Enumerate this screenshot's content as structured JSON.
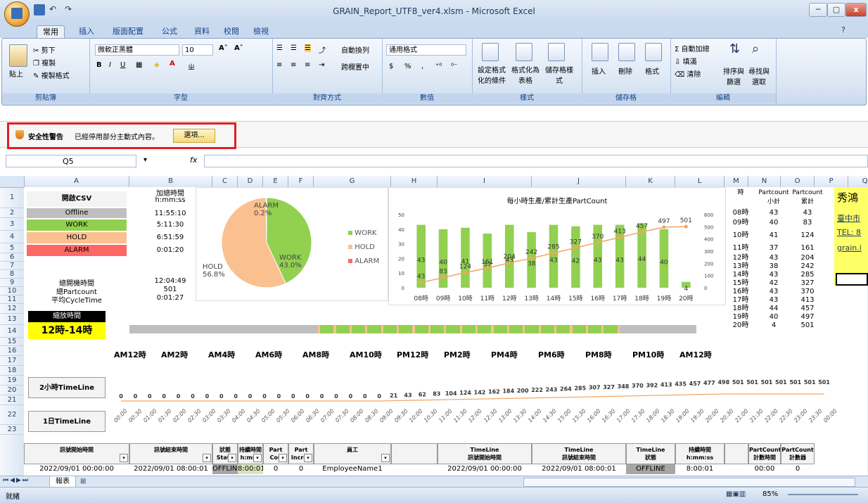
{
  "window": {
    "title": "GRAIN_Report_UTF8_ver4.xlsm - Microsoft Excel",
    "min": "─",
    "max": "▢",
    "close": "x"
  },
  "tabs": [
    "常用",
    "插入",
    "版面配置",
    "公式",
    "資料",
    "校閱",
    "檢視"
  ],
  "ribbon": {
    "clipboard": {
      "label": "剪貼簿",
      "paste": "貼上",
      "cut": "剪下",
      "copy": "複製",
      "format_painter": "複製格式"
    },
    "font": {
      "label": "字型",
      "name": "微軟正黑體",
      "size": "10"
    },
    "alignment": {
      "label": "對齊方式",
      "wrap": "自動換列",
      "merge": "跨欄置中"
    },
    "number": {
      "label": "數值",
      "format": "通用格式",
      "currency": "$",
      "percent": "%"
    },
    "styles": {
      "label": "樣式",
      "cond": "設定格式化的條件",
      "table": "格式化為表格",
      "cell": "儲存格樣式"
    },
    "cells": {
      "label": "儲存格",
      "insert": "插入",
      "delete": "刪除",
      "format": "格式"
    },
    "editing": {
      "label": "編輯",
      "autosum": "自動加總",
      "fill": "填滿",
      "clear": "清除",
      "sort": "排序與篩選",
      "find": "尋找與選取"
    }
  },
  "security": {
    "title": "安全性警告",
    "message": "已經停用部分主動式內容。",
    "button": "選項..."
  },
  "formula": {
    "namebox": "Q5",
    "fx": "fx"
  },
  "columns": [
    "A",
    "B",
    "C",
    "D",
    "E",
    "F",
    "G",
    "H",
    "I",
    "J",
    "K",
    "L",
    "M",
    "N",
    "O",
    "P",
    "Q"
  ],
  "rows": [
    "1",
    "2",
    "3",
    "4",
    "5",
    "6",
    "7",
    "8",
    "9",
    "10",
    "11",
    "12",
    "13",
    "14",
    "15",
    "16",
    "17",
    "18",
    "19",
    "20",
    "21",
    "22",
    "23"
  ],
  "summary": {
    "header_a": "開啟CSV",
    "header_b1": "加總時間",
    "header_b2": "h:mm:ss",
    "states": [
      {
        "name": "Offline",
        "time": "11:55:10",
        "color": "#bfbfbf"
      },
      {
        "name": "WORK",
        "time": "5:11:30",
        "color": "#92d050"
      },
      {
        "name": "HOLD",
        "time": "6:51:59",
        "color": "#fac090"
      },
      {
        "name": "ALARM",
        "time": "0:01:20",
        "color": "#ff6666"
      }
    ],
    "total_time_label": "總開機時間",
    "total_time": "12:04:49",
    "total_count_label": "總Partcount",
    "total_count": "501",
    "avg_cycle_label": "平均CycleTime",
    "avg_cycle": "0:01:27"
  },
  "pie": {
    "labels": [
      {
        "name": "ALARM",
        "pct": "0.2%"
      },
      {
        "name": "WORK",
        "pct": "43.0%"
      },
      {
        "name": "HOLD",
        "pct": "56.8%"
      }
    ],
    "legend": [
      "WORK",
      "HOLD",
      "ALARM"
    ]
  },
  "chart_data": {
    "type": "bar",
    "title": "每小時生產/累計生產PartCount",
    "categories": [
      "08時",
      "09時",
      "10時",
      "11時",
      "12時",
      "13時",
      "14時",
      "15時",
      "16時",
      "17時",
      "18時",
      "19時",
      "20時"
    ],
    "series": [
      {
        "values": [
          43,
          40,
          41,
          37,
          43,
          38,
          43,
          42,
          43,
          43,
          44,
          40,
          4
        ]
      },
      {
        "values": [
          43,
          83,
          124,
          161,
          204,
          242,
          285,
          327,
          370,
          413,
          457,
          497,
          501
        ]
      }
    ],
    "y_left_ticks": [
      "50",
      "40",
      "30",
      "20",
      "10",
      "0"
    ],
    "y_right_ticks": [
      "600",
      "500",
      "400",
      "300",
      "200",
      "100",
      "0"
    ],
    "ylim_left": [
      0,
      50
    ],
    "ylim_right": [
      0,
      600
    ]
  },
  "hourly_table": {
    "header_hour": "時",
    "header_sub": "Partcount\n小計",
    "header_cum": "Partcount\n累計",
    "rows": [
      [
        "08時",
        "43",
        "43"
      ],
      [
        "09時",
        "40",
        "83"
      ],
      [
        "10時",
        "41",
        "124"
      ],
      [
        "11時",
        "37",
        "161"
      ],
      [
        "12時",
        "43",
        "204"
      ],
      [
        "13時",
        "38",
        "242"
      ],
      [
        "14時",
        "43",
        "285"
      ],
      [
        "15時",
        "42",
        "327"
      ],
      [
        "16時",
        "43",
        "370"
      ],
      [
        "17時",
        "43",
        "413"
      ],
      [
        "18時",
        "44",
        "457"
      ],
      [
        "19時",
        "40",
        "497"
      ],
      [
        "20時",
        "4",
        "501"
      ]
    ]
  },
  "company": {
    "name": "秀鴻",
    "addr": "臺中市",
    "tel": "TEL: 8",
    "mail": "grain.i"
  },
  "zoom": {
    "label": "縮放時間",
    "value": "12時-14時"
  },
  "timeline_axis": [
    "AM12時",
    "AM2時",
    "AM4時",
    "AM6時",
    "AM8時",
    "AM10時",
    "PM12時",
    "PM2時",
    "PM4時",
    "PM6時",
    "PM8時",
    "PM10時",
    "AM12時"
  ],
  "timeline2h": {
    "label": "2小時TimeLine",
    "values": [
      "0",
      "0",
      "0",
      "0",
      "0",
      "0",
      "0",
      "0",
      "0",
      "0",
      "0",
      "0",
      "0",
      "0",
      "0",
      "0",
      "0",
      "0",
      "0",
      "21",
      "43",
      "62",
      "83",
      "104",
      "124",
      "142",
      "162",
      "184",
      "200",
      "222",
      "243",
      "264",
      "285",
      "307",
      "327",
      "348",
      "370",
      "392",
      "413",
      "435",
      "457",
      "477",
      "498",
      "501",
      "501",
      "501",
      "501",
      "501",
      "501",
      "501"
    ]
  },
  "timeline1h": {
    "label": "1日TimeLine",
    "times": [
      "00:00",
      "00:30",
      "01:00",
      "01:30",
      "02:00",
      "02:30",
      "03:00",
      "03:30",
      "04:00",
      "04:30",
      "05:00",
      "05:30",
      "06:00",
      "06:30",
      "07:00",
      "07:30",
      "08:00",
      "08:30",
      "09:00",
      "09:30",
      "10:00",
      "10:30",
      "11:00",
      "11:30",
      "12:00",
      "12:30",
      "13:00",
      "13:30",
      "14:00",
      "14:30",
      "15:00",
      "15:30",
      "16:00",
      "16:30",
      "17:00",
      "17:30",
      "18:00",
      "18:30",
      "19:00",
      "19:30",
      "20:00",
      "20:30",
      "21:00",
      "21:30",
      "22:00",
      "22:30",
      "23:00",
      "23:30",
      "00:00"
    ]
  },
  "table_header": [
    "訊號開始時間",
    "訊號結束時間",
    "狀態\nStatu",
    "持續時間\nh:mm:",
    "Part\nCou",
    "Part\nIncrea",
    "員工",
    "",
    "TimeLine\n訊號開始時間",
    "TimeLine\n訊號結束時間",
    "TimeLine\n狀態",
    "持續時間\nh:mm:ss",
    "",
    "PartCount\n計數時間",
    "PartCount\n計數器"
  ],
  "table_row": [
    "2022/09/01 00:00:00",
    "2022/09/01 08:00:01",
    "OFFLINE",
    "8:00:01",
    "0",
    "0",
    "EmployeeName1",
    "",
    "2022/09/01 00:00:00",
    "2022/09/01 08:00:01",
    "OFFLINE",
    "8:00:01",
    "",
    "00:00",
    "0"
  ],
  "sheet": {
    "tab": "報表"
  },
  "status": {
    "ready": "就緒",
    "zoom": "85%"
  }
}
